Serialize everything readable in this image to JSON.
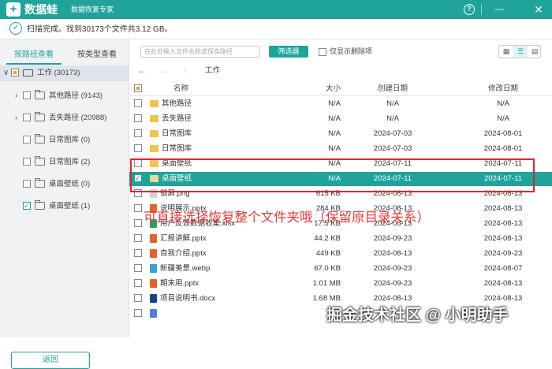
{
  "app": {
    "name": "数据蛙",
    "subtitle": "数据恢复专家",
    "logo_glyph": "+",
    "accent_color": "#1fa39a"
  },
  "titlebar_icons": [
    "help-icon",
    "minimize-icon",
    "close-icon"
  ],
  "status": {
    "text": "扫描完成。找到30173个文件共3.12 GB。"
  },
  "sidebar": {
    "tabs": [
      {
        "label": "按路径查看",
        "active": true
      },
      {
        "label": "按类型查看",
        "active": false
      }
    ],
    "tree": [
      {
        "label": "工作 (30173)",
        "level": 0,
        "check": "partial",
        "expandable": true,
        "icon": "drive-icon",
        "selected": true
      },
      {
        "label": "其他路径 (9143)",
        "level": 1,
        "check": "none",
        "expandable": true,
        "icon": "folder-icon"
      },
      {
        "label": "丢失路径 (20988)",
        "level": 1,
        "check": "none",
        "expandable": true,
        "icon": "folder-icon"
      },
      {
        "label": "日常图库 (0)",
        "level": 1,
        "check": "none",
        "expandable": false,
        "icon": "folder-icon"
      },
      {
        "label": "日常图库 (2)",
        "level": 1,
        "check": "none",
        "expandable": false,
        "icon": "folder-icon"
      },
      {
        "label": "桌面壁纸 (0)",
        "level": 1,
        "check": "none",
        "expandable": false,
        "icon": "folder-icon"
      },
      {
        "label": "桌面壁纸 (1)",
        "level": 1,
        "check": "checked",
        "expandable": false,
        "icon": "folder-icon"
      }
    ],
    "back_button": "返回"
  },
  "toolbar": {
    "search_placeholder": "在此处输入文件名称或保存路径",
    "filter_button": "筛选器",
    "only_deleted_label": "仅显示删除项",
    "views": [
      "grid-view-icon",
      "list-view-icon",
      "detail-view-icon"
    ],
    "active_view": "list-view-icon"
  },
  "nav": {
    "breadcrumb": "工作"
  },
  "table": {
    "columns": {
      "name": "名称",
      "size": "大小",
      "created": "创建日期",
      "modified": "修改日期"
    },
    "rows": [
      {
        "name": "其他路径",
        "size": "N/A",
        "created": "N/A",
        "modified": "N/A",
        "icon": "folder-icon",
        "checked": false,
        "selected": false
      },
      {
        "name": "丢失路径",
        "size": "N/A",
        "created": "N/A",
        "modified": "N/A",
        "icon": "folder-icon",
        "checked": false,
        "selected": false
      },
      {
        "name": "日常图库",
        "size": "N/A",
        "created": "2024-07-03",
        "modified": "2024-08-01",
        "icon": "folder-icon",
        "checked": false,
        "selected": false
      },
      {
        "name": "日常图库",
        "size": "N/A",
        "created": "2024-07-03",
        "modified": "2024-08-01",
        "icon": "folder-icon",
        "checked": false,
        "selected": false
      },
      {
        "name": "桌面壁纸",
        "size": "N/A",
        "created": "2024-07-11",
        "modified": "2024-07-11",
        "icon": "folder-icon",
        "checked": false,
        "selected": false
      },
      {
        "name": "桌面壁纸",
        "size": "N/A",
        "created": "2024-07-11",
        "modified": "2024-07-11",
        "icon": "folder-icon",
        "checked": true,
        "selected": true
      },
      {
        "name": "锁屏.png",
        "size": "615 KB",
        "created": "2024-08-13",
        "modified": "2024-08-13",
        "icon": "image-file-icon",
        "checked": false,
        "selected": false
      },
      {
        "name": "说明展示.pptx",
        "size": "284 KB",
        "created": "2024-08-13",
        "modified": "2024-08-13",
        "icon": "pptx-file-icon",
        "checked": false,
        "selected": false
      },
      {
        "name": "用户反馈数据收集.xlsx",
        "size": "17.5 KB",
        "created": "2024-08-13",
        "modified": "2024-08-13",
        "icon": "xlsx-file-icon",
        "checked": false,
        "selected": false
      },
      {
        "name": "汇报讲解.pptx",
        "size": "44.2 KB",
        "created": "2024-09-23",
        "modified": "2024-08-13",
        "icon": "pptx-file-icon",
        "checked": false,
        "selected": false
      },
      {
        "name": "自我介绍.pptx",
        "size": "449 KB",
        "created": "2024-08-13",
        "modified": "2024-09-23",
        "icon": "pptx-file-icon",
        "checked": false,
        "selected": false
      },
      {
        "name": "新疆美景.webp",
        "size": "67.0 KB",
        "created": "2024-09-23",
        "modified": "2024-08-07",
        "icon": "webp-file-icon",
        "checked": false,
        "selected": false
      },
      {
        "name": "期末用.pptx",
        "size": "1.01 MB",
        "created": "2024-09-23",
        "modified": "2024-08-13",
        "icon": "pptx-file-icon",
        "checked": false,
        "selected": false
      },
      {
        "name": "项目说明书.docx",
        "size": "1.68 MB",
        "created": "2024-08-13",
        "modified": "2024-08-13",
        "icon": "docx-file-icon",
        "checked": false,
        "selected": false
      },
      {
        "name": "",
        "size": "",
        "created": "",
        "modified": "",
        "icon": "file-icon",
        "checked": false,
        "selected": false
      }
    ]
  },
  "overlay_text": "可直接选择恢复整个文件夹哦（保留原目录关系）",
  "watermark": "掘金技术社区 @ 小明助手"
}
